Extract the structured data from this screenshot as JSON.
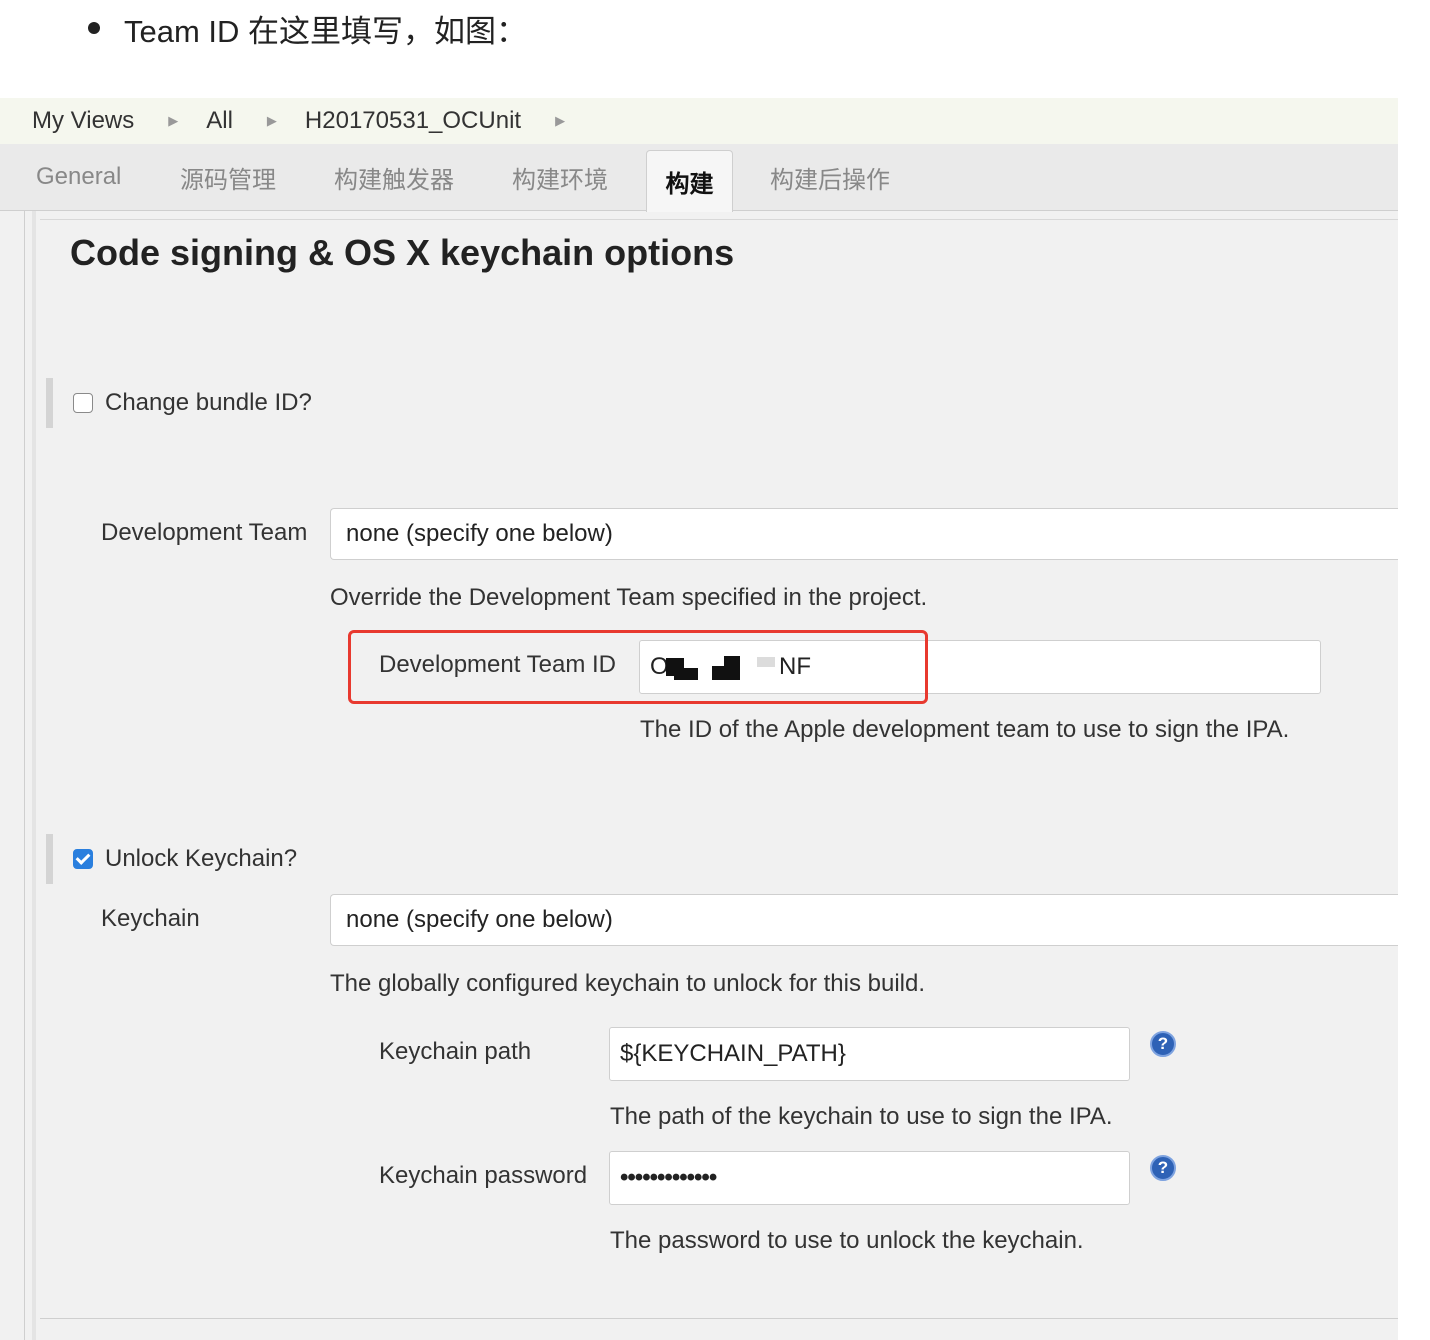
{
  "intro": {
    "text": "Team ID 在这里填写，如图："
  },
  "breadcrumb": [
    {
      "label": "My Views"
    },
    {
      "label": "All"
    },
    {
      "label": "H20170531_OCUnit"
    }
  ],
  "tabs": [
    {
      "label": "General"
    },
    {
      "label": "源码管理"
    },
    {
      "label": "构建触发器"
    },
    {
      "label": "构建环境"
    },
    {
      "label": "构建"
    },
    {
      "label": "构建后操作"
    }
  ],
  "section": {
    "title": "Code signing & OS X keychain options"
  },
  "change_bundle": {
    "label": "Change bundle ID?",
    "checked": false
  },
  "dev_team": {
    "label": "Development Team",
    "value": "none (specify one below)",
    "help": "Override the Development Team specified in the project."
  },
  "dev_team_id": {
    "label": "Development Team ID",
    "value_visible_start": "O",
    "value_visible_end": "NF",
    "help": "The ID of the Apple development team to use to sign the IPA.",
    "highlight_color": "#e8392f"
  },
  "unlock_keychain": {
    "label": "Unlock Keychain?",
    "checked": true
  },
  "keychain": {
    "label": "Keychain",
    "value": "none (specify one below)",
    "help": "The globally configured keychain to unlock for this build."
  },
  "keychain_path": {
    "label": "Keychain path",
    "value": "${KEYCHAIN_PATH}",
    "help": "The path of the keychain to use to sign the IPA."
  },
  "keychain_password": {
    "label": "Keychain password",
    "value": "•••••••••••••",
    "help": "The password to use to unlock the keychain."
  },
  "icons": {
    "help": "question-mark-icon",
    "bullet": "bullet-dot",
    "crumb_separator": "triangle-right"
  },
  "colors": {
    "checkbox_checked": "#2a7fde",
    "help_icon": "#2e62b6",
    "breadcrumb_bg": "#f5f7ee"
  }
}
